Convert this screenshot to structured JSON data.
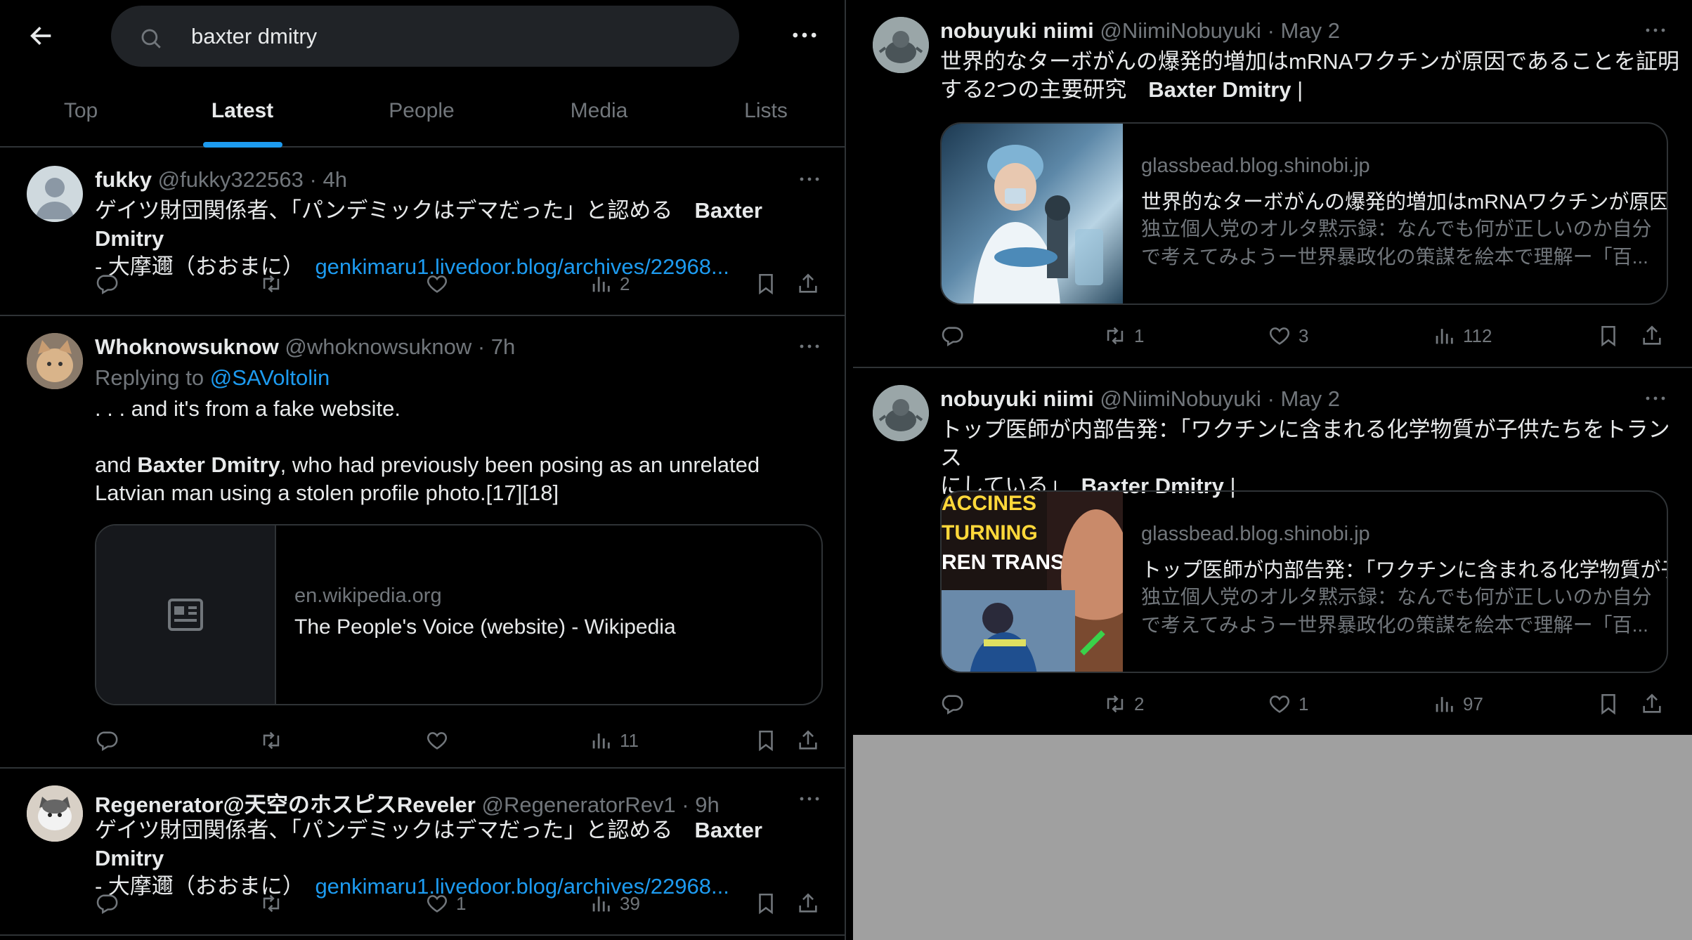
{
  "search": {
    "query": "baxter dmitry"
  },
  "tabs": [
    {
      "label": "Top",
      "active": false
    },
    {
      "label": "Latest",
      "active": true
    },
    {
      "label": "People",
      "active": false
    },
    {
      "label": "Media",
      "active": false
    },
    {
      "label": "Lists",
      "active": false
    }
  ],
  "left_tweets": [
    {
      "name": "fukky",
      "handle": "@fukky322563",
      "time": "· 4h",
      "text_before": "ゲイツ財団関係者、「パンデミックはデマだった」と認める　",
      "text_bold": "Baxter Dmitry",
      "text_after": "- 大摩邇（おおまに）",
      "link": "genkimaru1.livedoor.blog/archives/22968...",
      "views": "2",
      "likes": "",
      "retweets": ""
    },
    {
      "name": "Whoknowsuknow",
      "handle": "@whoknowsuknow",
      "time": "· 7h",
      "replying_label": "Replying to",
      "replying_to": "@SAVoltolin",
      "line1": ". . .  and it's from a fake website.",
      "line2_before": "and ",
      "line2_bold": "Baxter Dmitry",
      "line2_after": ", who had previously been posing as an unrelated",
      "line3": "Latvian man using a stolen profile photo.[17][18]",
      "card_domain": "en.wikipedia.org",
      "card_title": "The People's Voice (website) - Wikipedia",
      "views": "11",
      "likes": "",
      "retweets": ""
    },
    {
      "name": "Regenerator@天空のホスピスReveler",
      "handle": "@RegeneratorRev1",
      "time": "· 9h",
      "text_before": "ゲイツ財団関係者、「パンデミックはデマだった」と認める　",
      "text_bold": "Baxter Dmitry",
      "text_after": "- 大摩邇（おおまに）",
      "link": "genkimaru1.livedoor.blog/archives/22968...",
      "views": "39",
      "likes": "1",
      "retweets": ""
    }
  ],
  "right_tweets": [
    {
      "name": "nobuyuki niimi",
      "handle": "@NiimiNobuyuki",
      "time": "· May 2",
      "line1": "世界的なターボがんの爆発的増加はmRNAワクチンが原因であることを証明",
      "line2_before": "する2つの主要研究　",
      "line2_bold": "Baxter Dmitry",
      "line2_after": " |",
      "card_domain": "glassbead.blog.shinobi.jp",
      "card_title": "世界的なターボがんの爆発的増加はmRNAワクチンが原因",
      "card_desc1": "独立個人党のオルタ黙示録：なんでも何が正しいのか自分",
      "card_desc2": "で考えてみようー世界暴政化の策謀を絵本で理解ー「百...",
      "retweets": "1",
      "likes": "3",
      "views": "112"
    },
    {
      "name": "nobuyuki niimi",
      "handle": "@NiimiNobuyuki",
      "time": "· May 2",
      "line1": "トップ医師が内部告発：「ワクチンに含まれる化学物質が子供たちをトランス",
      "line2_before": "にしている」　",
      "line2_bold": "Baxter Dmitry",
      "line2_after": " |",
      "card_domain": "glassbead.blog.shinobi.jp",
      "card_title": "トップ医師が内部告発：「ワクチンに含まれる化学物質が子",
      "card_desc1": "独立個人党のオルタ黙示録：なんでも何が正しいのか自分",
      "card_desc2": "で考えてみようー世界暴政化の策謀を絵本で理解ー「百...",
      "thumb_text1": "ACCINES",
      "thumb_text2": "TURNING",
      "thumb_text3": "REN TRANS'",
      "retweets": "2",
      "likes": "1",
      "views": "97"
    }
  ]
}
